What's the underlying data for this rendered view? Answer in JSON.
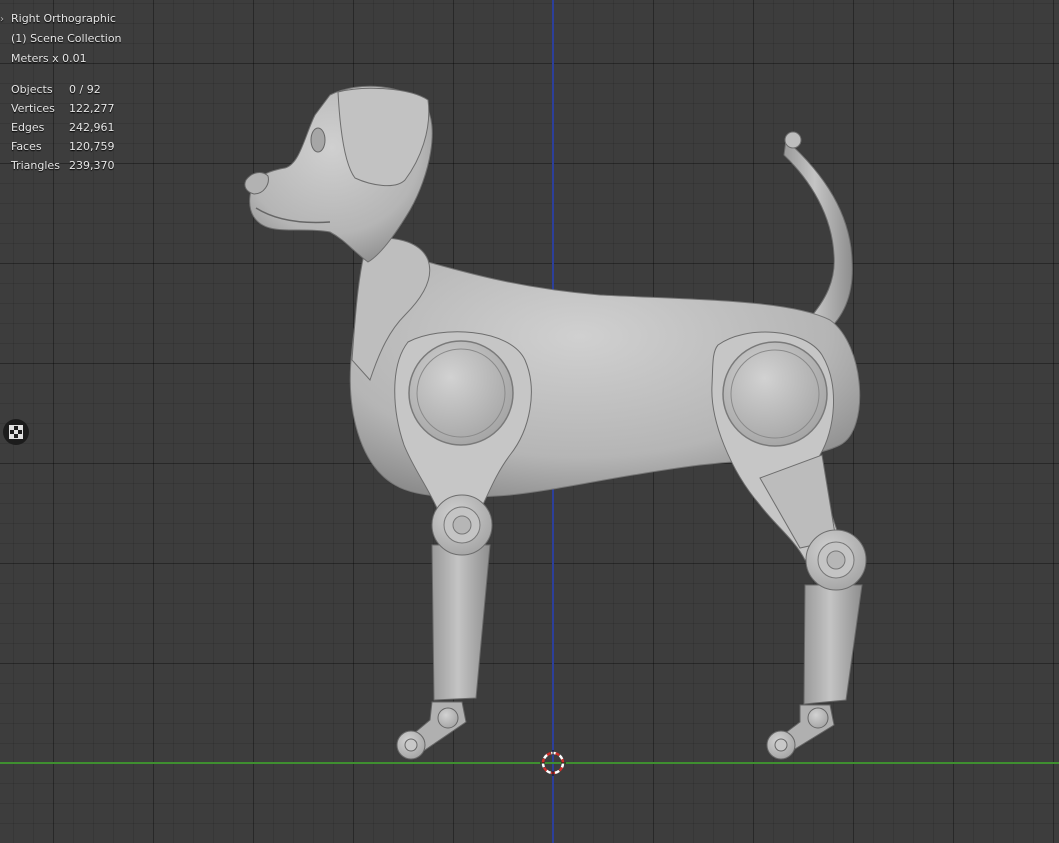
{
  "viewport": {
    "view_name": "Right Orthographic",
    "collection": "(1) Scene Collection",
    "units": "Meters x 0.01",
    "stats": [
      {
        "label": "Objects",
        "value": "0 / 92"
      },
      {
        "label": "Vertices",
        "value": "122,277"
      },
      {
        "label": "Edges",
        "value": "242,961"
      },
      {
        "label": "Faces",
        "value": "120,759"
      },
      {
        "label": "Triangles",
        "value": "239,370"
      }
    ],
    "side_button_icon": "grid-toggle-icon",
    "cursor_icon": "3d-cursor-icon",
    "colors": {
      "background": "#3d3d3d",
      "x_axis": "#3f8f30",
      "z_axis": "#2c3f9a",
      "model": "#b8b8b8"
    }
  }
}
